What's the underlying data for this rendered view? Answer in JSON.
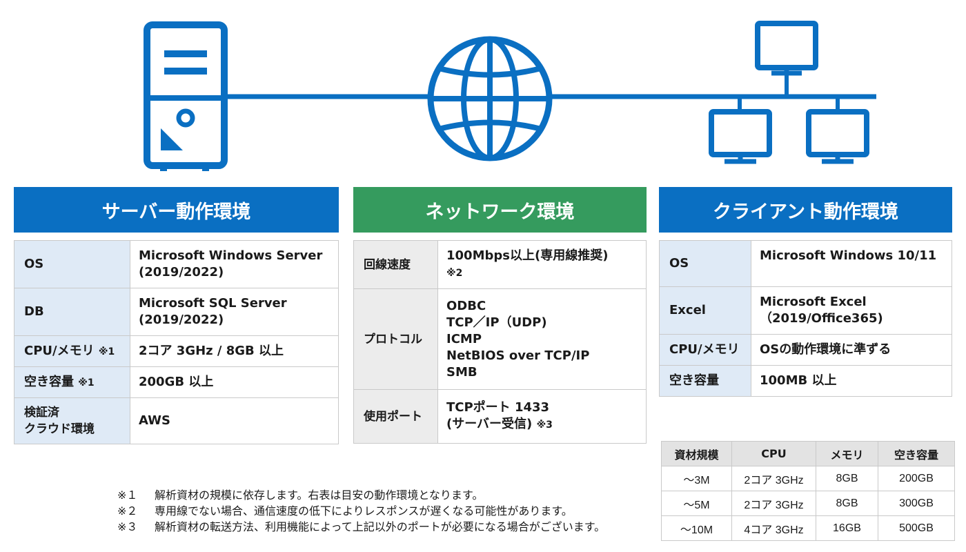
{
  "colors": {
    "blue": "#0a6fc2",
    "green": "#359b5e",
    "label_blue_bg": "#dfeaf6",
    "label_gray_bg": "#ececec"
  },
  "icons": [
    "server-icon",
    "globe-icon",
    "client-computers-icon"
  ],
  "server": {
    "title": "サーバー動作環境",
    "rows": [
      {
        "label": "OS",
        "note": "",
        "value": "Microsoft Windows Server\n(2019/2022)"
      },
      {
        "label": "DB",
        "note": "",
        "value": "Microsoft SQL Server\n(2019/2022)"
      },
      {
        "label": "CPU/メモリ",
        "note": "※1",
        "value": "2コア 3GHz / 8GB 以上"
      },
      {
        "label": "空き容量",
        "note": "※1",
        "value": "200GB 以上"
      },
      {
        "label": "検証済\nクラウド環境",
        "note": "",
        "value": "AWS"
      }
    ]
  },
  "network": {
    "title": "ネットワーク環境",
    "rows": [
      {
        "label": "回線速度",
        "value": "100Mbps以上(専用線推奨)",
        "note": "※2"
      },
      {
        "label": "プロトコル",
        "value": "ODBC\nTCP／IP（UDP)\nICMP\nNetBIOS over TCP/IP\nSMB",
        "note": ""
      },
      {
        "label": "使用ポート",
        "value": "TCPポート 1433\n(サーバー受信)",
        "note": "※3"
      }
    ]
  },
  "client": {
    "title": "クライアント動作環境",
    "rows": [
      {
        "label": "OS",
        "value": "Microsoft Windows 10/11"
      },
      {
        "label": "Excel",
        "value": "Microsoft Excel\n（2019/Office365)"
      },
      {
        "label": "CPU/メモリ",
        "value": "OSの動作環境に準ずる"
      },
      {
        "label": "空き容量",
        "value": "100MB 以上"
      }
    ]
  },
  "sizing": {
    "headers": [
      "資材規模",
      "CPU",
      "メモリ",
      "空き容量"
    ],
    "rows": [
      [
        "～3M",
        "2コア 3GHz",
        "8GB",
        "200GB"
      ],
      [
        "～5M",
        "2コア 3GHz",
        "8GB",
        "300GB"
      ],
      [
        "～10M",
        "4コア 3GHz",
        "16GB",
        "500GB"
      ]
    ]
  },
  "footnotes": [
    {
      "mark": "※１",
      "text": "解析資材の規模に依存します。右表は目安の動作環境となります。"
    },
    {
      "mark": "※２",
      "text": "専用線でない場合、通信速度の低下によりレスポンスが遅くなる可能性があります。"
    },
    {
      "mark": "※３",
      "text": "解析資材の転送方法、利用機能によって上記以外のポートが必要になる場合がございます。"
    }
  ]
}
